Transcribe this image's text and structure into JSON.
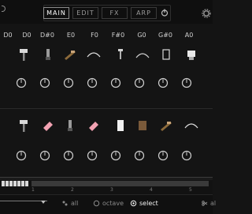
{
  "tabs": [
    "MAIN",
    "EDIT",
    "FX",
    "ARP"
  ],
  "active_tab": "MAIN",
  "notes": [
    "D0",
    "D#0",
    "E0",
    "F0",
    "F#0",
    "G0",
    "G#0",
    "A0"
  ],
  "bottom": {
    "all_label": "all",
    "octave_label": "octave",
    "select_label": "select",
    "cut_label": "al"
  },
  "octave_numbers": [
    "1",
    "2",
    "3",
    "4",
    "5"
  ],
  "colors": {
    "accent": "#c89a3a",
    "bg": "#141414"
  },
  "icons": [
    "power-icon",
    "gear-icon",
    "hammer-icon",
    "knife-icon",
    "clip-icon",
    "whip-icon",
    "screw-icon",
    "curve-icon",
    "brush-icon",
    "eraser-icon",
    "wood-block-icon",
    "paper-icon",
    "glass-icon"
  ]
}
